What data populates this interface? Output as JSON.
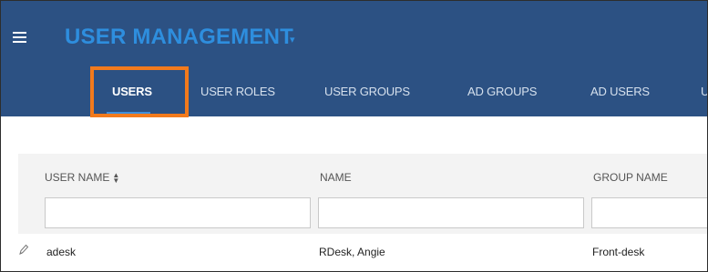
{
  "header": {
    "title": "USER MANAGEMENT",
    "title_caret": "▾",
    "menu_icon": "hamburger-menu-icon"
  },
  "tabs": [
    {
      "label": "USERS",
      "active": true
    },
    {
      "label": "USER ROLES",
      "active": false
    },
    {
      "label": "USER GROUPS",
      "active": false
    },
    {
      "label": "AD GROUPS",
      "active": false
    },
    {
      "label": "AD USERS",
      "active": false
    },
    {
      "label": "U",
      "active": false
    }
  ],
  "table": {
    "columns": [
      {
        "label": "USER NAME",
        "sortable": true,
        "sort_icon": "sort-icon"
      },
      {
        "label": "NAME",
        "sortable": false
      },
      {
        "label": "GROUP NAME",
        "sortable": false
      }
    ],
    "filters": [
      "",
      "",
      ""
    ],
    "rows": [
      {
        "edit_icon": "pencil-icon",
        "user_name": "adesk",
        "name": "RDesk, Angie",
        "group_name": "Front-desk"
      }
    ]
  },
  "colors": {
    "header_bg": "#2c5183",
    "title": "#2e8ede",
    "active_tab_underline": "#3f8fdc",
    "highlight_box": "#f27a1c",
    "grid_header_bg": "#f3f3f3"
  }
}
